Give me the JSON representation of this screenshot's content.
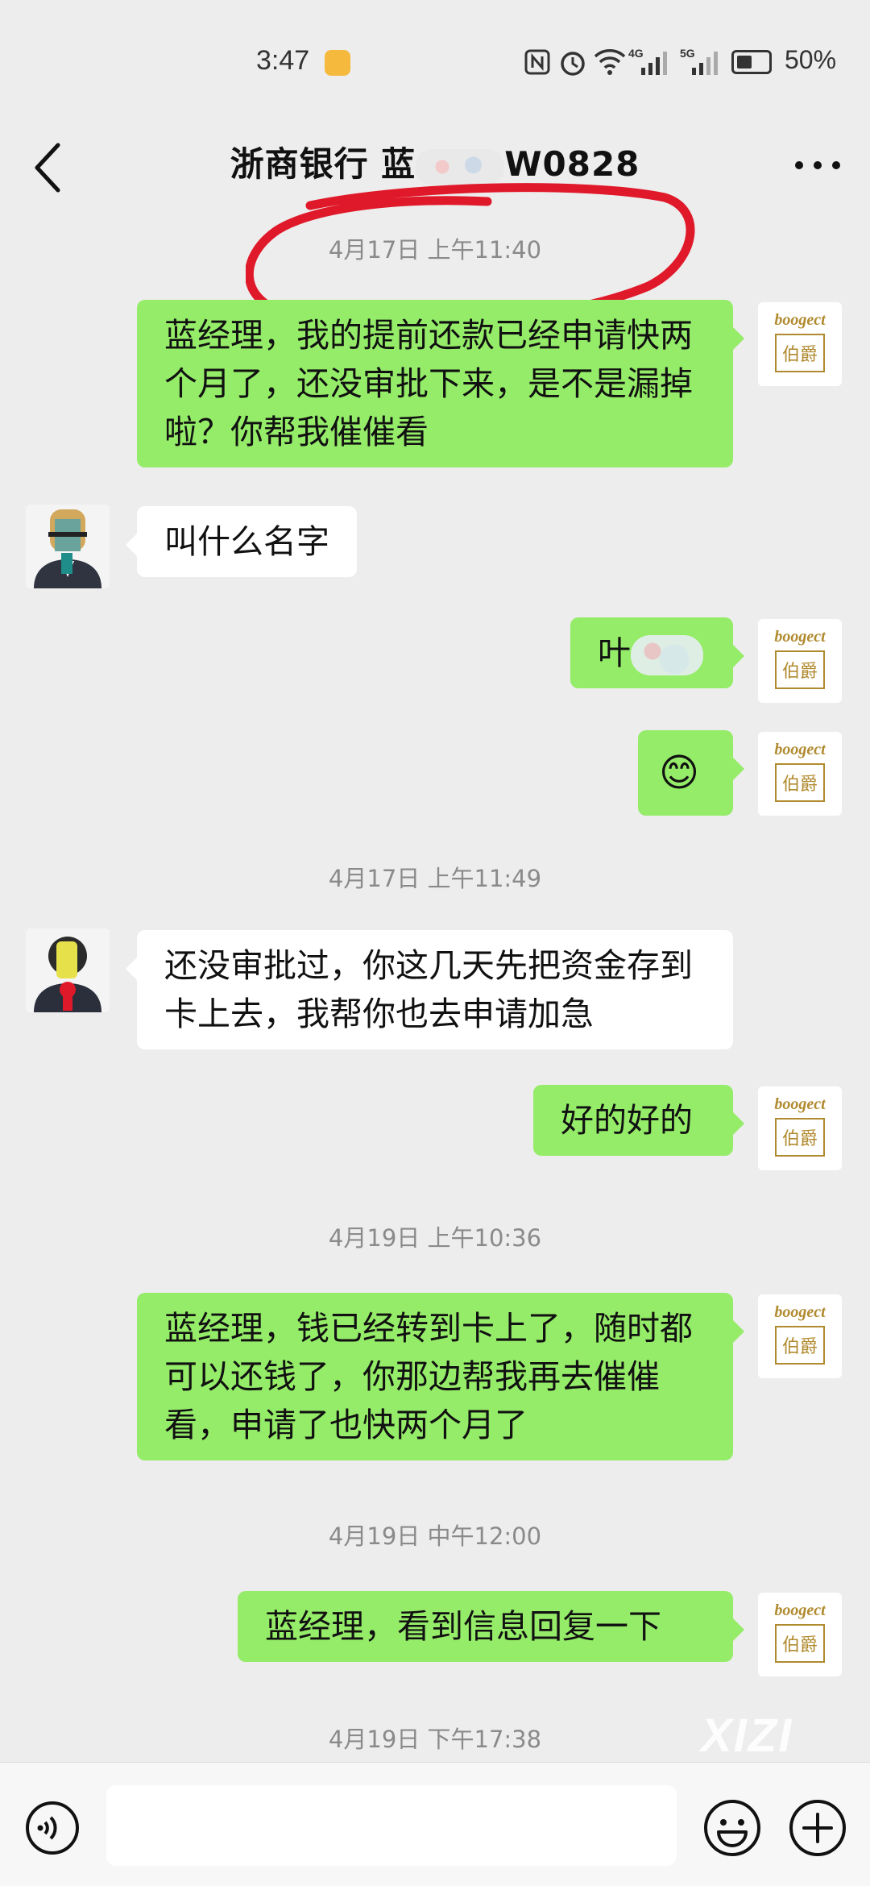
{
  "status_bar": {
    "time": "3:47",
    "signal_1": "4G",
    "signal_2": "5G",
    "battery": "50%"
  },
  "header": {
    "title_prefix": "浙商银行  蓝",
    "title_suffix": "W0828"
  },
  "brand_avatar": {
    "name": "boogect",
    "mark": "伯爵"
  },
  "messages": [
    {
      "type": "time",
      "text": "4月17日 上午11:40"
    },
    {
      "type": "me",
      "text": "蓝经理，我的提前还款已经申请快两个月了，还没审批下来，是不是漏掉啦？你帮我催催看"
    },
    {
      "type": "other",
      "text": "叫什么名字"
    },
    {
      "type": "me",
      "text": "叶"
    },
    {
      "type": "me",
      "text": "😊"
    },
    {
      "type": "time",
      "text": "4月17日 上午11:49"
    },
    {
      "type": "other",
      "text": "还没审批过，你这几天先把资金存到卡上去，我帮你也去申请加急"
    },
    {
      "type": "me",
      "text": "好的好的"
    },
    {
      "type": "time",
      "text": "4月19日 上午10:36"
    },
    {
      "type": "me",
      "text": "蓝经理，钱已经转到卡上了，随时都可以还钱了，你那边帮我再去催催看，申请了也快两个月了"
    },
    {
      "type": "time",
      "text": "4月19日 中午12:00"
    },
    {
      "type": "me",
      "text": "蓝经理，看到信息回复一下"
    },
    {
      "type": "time",
      "text": "4月19日 下午17:38"
    }
  ],
  "watermark": "XIZI",
  "colors": {
    "bubble_me": "#95ec69",
    "background": "#ededed",
    "annotation": "#e0192a"
  }
}
